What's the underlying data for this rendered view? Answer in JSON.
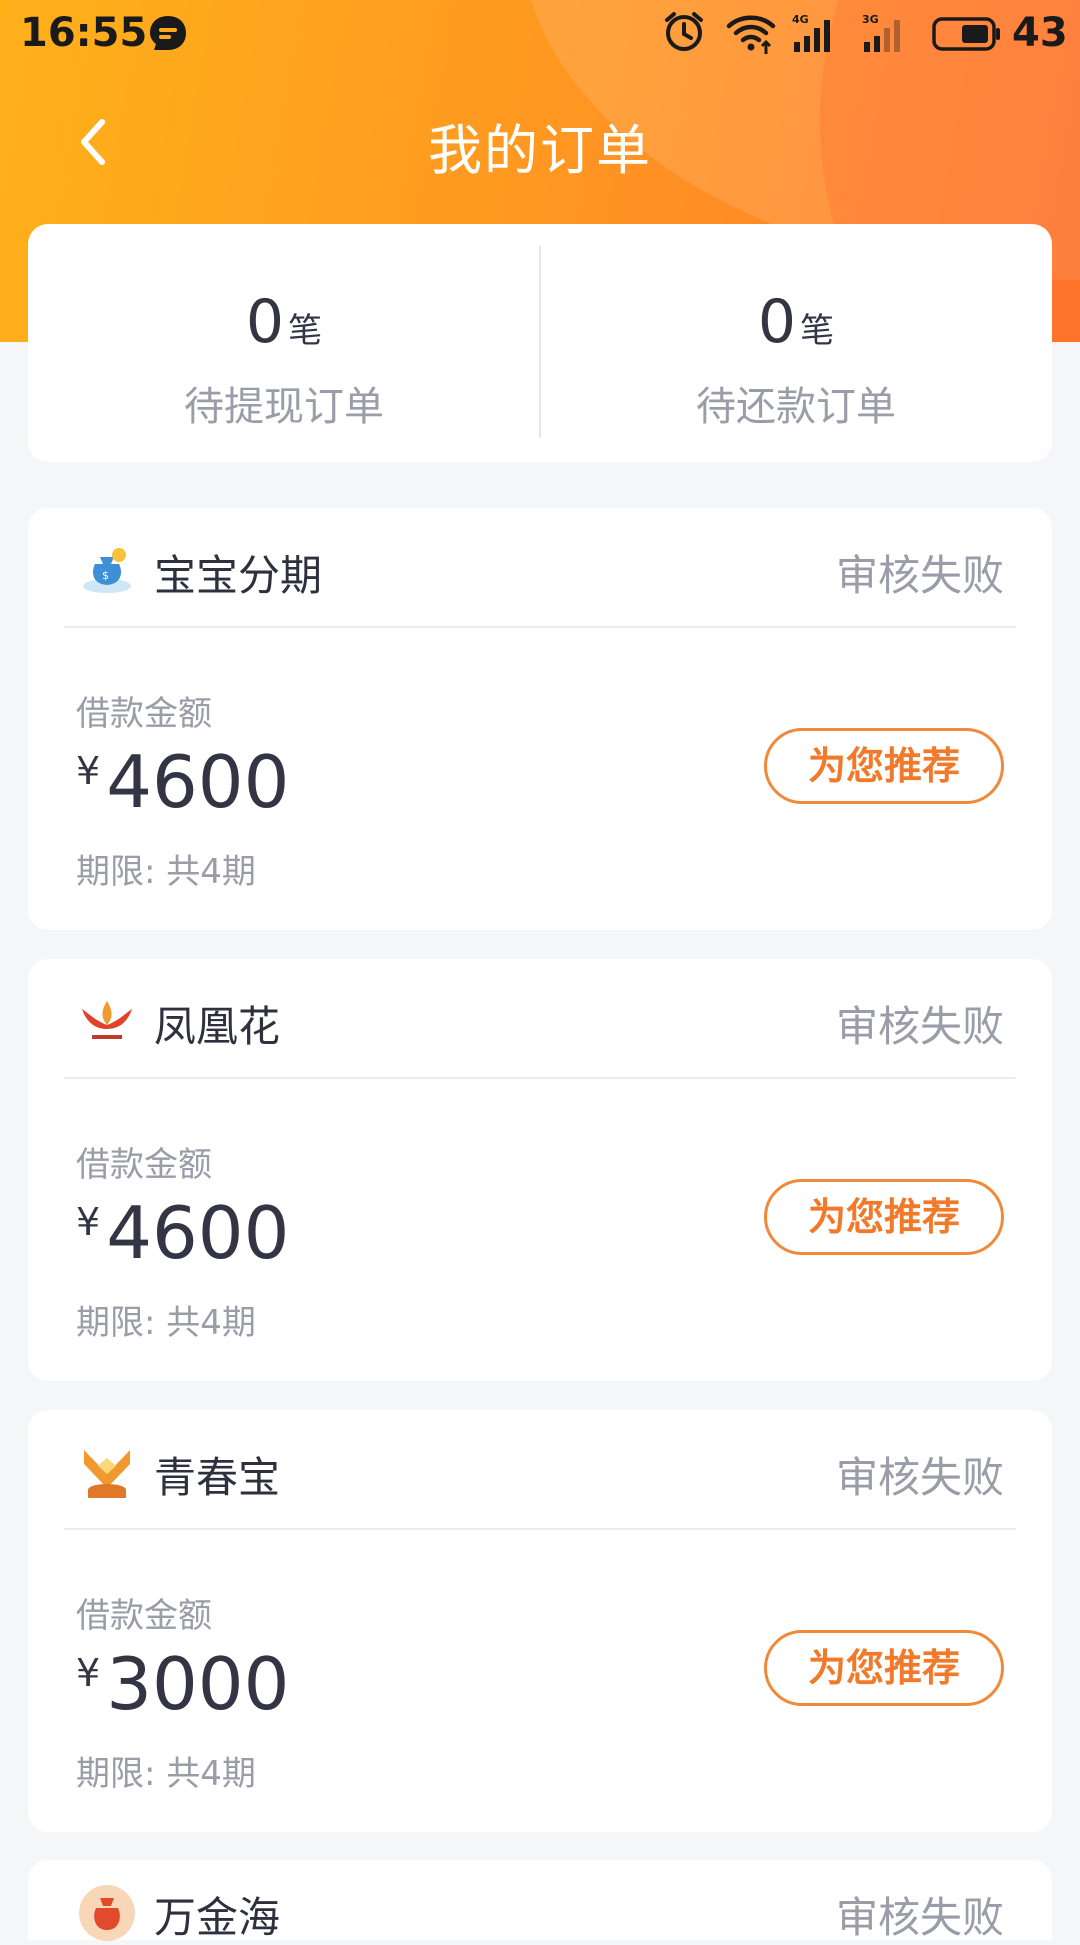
{
  "status_bar": {
    "time": "16:55",
    "battery": "43",
    "icons": [
      "chat-bubble-icon",
      "alarm-icon",
      "wifi-icon",
      "signal-4g-icon",
      "signal-3g-icon",
      "battery-icon"
    ]
  },
  "nav": {
    "title": "我的订单",
    "back_icon": "chevron-left-icon"
  },
  "summary": {
    "items": [
      {
        "value": "0",
        "unit": "笔",
        "label": "待提现订单"
      },
      {
        "value": "0",
        "unit": "笔",
        "label": "待还款订单"
      }
    ]
  },
  "orders": [
    {
      "name": "宝宝分期",
      "status": "审核失败",
      "amount_label": "借款金额",
      "currency": "¥",
      "amount": "4600",
      "term": "期限: 共4期",
      "button": "为您推荐",
      "logo_icon": "money-bag-logo-icon"
    },
    {
      "name": "凤凰花",
      "status": "审核失败",
      "amount_label": "借款金额",
      "currency": "¥",
      "amount": "4600",
      "term": "期限: 共4期",
      "button": "为您推荐",
      "logo_icon": "phoenix-logo-icon"
    },
    {
      "name": "青春宝",
      "status": "审核失败",
      "amount_label": "借款金额",
      "currency": "¥",
      "amount": "3000",
      "term": "期限: 共4期",
      "button": "为您推荐",
      "logo_icon": "treasure-logo-icon"
    },
    {
      "name": "万金海",
      "status": "审核失败",
      "logo_icon": "coin-bag-logo-icon"
    }
  ],
  "colors": {
    "header_start": "#ffb11a",
    "header_end": "#ff7a2b",
    "accent": "#f07a2a",
    "text_dark": "#333544",
    "text_muted": "#9a9ca8",
    "background": "#f5f6f8"
  }
}
